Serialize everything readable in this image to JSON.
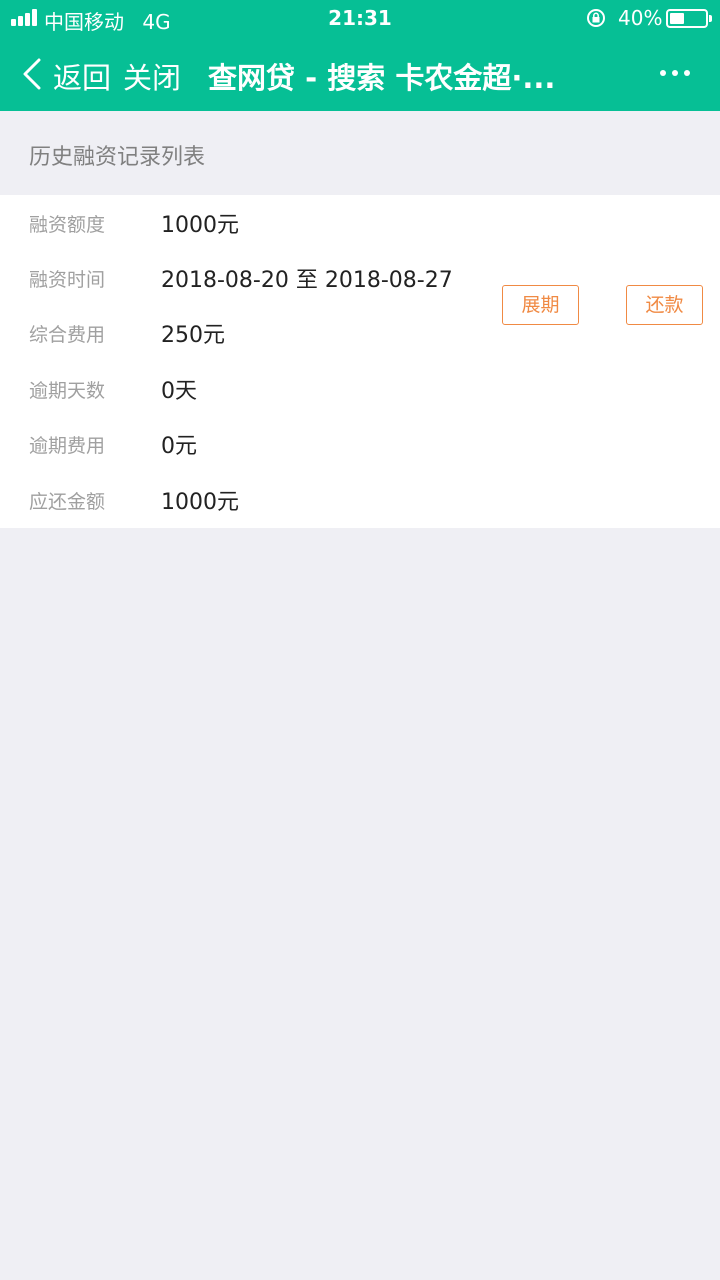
{
  "status_bar": {
    "carrier": "中国移动",
    "network": "4G",
    "time": "21:31",
    "battery_percent": "40%",
    "battery_level": 0.4
  },
  "nav": {
    "back_label": "返回",
    "close_label": "关闭",
    "title": "查网贷 - 搜索 卡农金超·..."
  },
  "section_title": "历史融资记录列表",
  "record": {
    "rows": [
      {
        "label": "融资额度",
        "value": "1000元"
      },
      {
        "label": "融资时间",
        "value": "2018-08-20 至 2018-08-27"
      },
      {
        "label": "综合费用",
        "value": "250元"
      },
      {
        "label": "逾期天数",
        "value": "0天"
      },
      {
        "label": "逾期费用",
        "value": "0元"
      },
      {
        "label": "应还金额",
        "value": "1000元"
      }
    ],
    "extend_label": "展期",
    "repay_label": "还款"
  },
  "colors": {
    "header": "#06bf95",
    "accent_orange": "#f08a44",
    "background": "#efeff4"
  },
  "icons": [
    "signal-icon",
    "lock-rotation-icon",
    "battery-icon",
    "back-chevron-icon",
    "more-icon"
  ]
}
